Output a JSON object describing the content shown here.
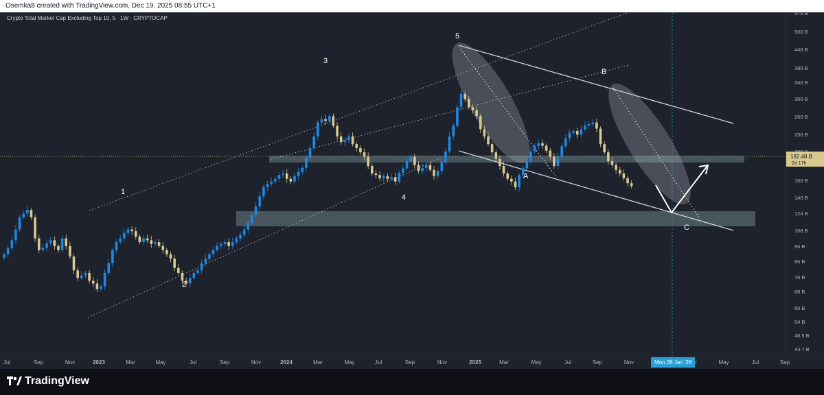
{
  "header": {
    "credit": "Osemka8 created with TradingView.com, Dec 19, 2025 08:55 UTC+1"
  },
  "chart_title": "Crypto Total Market Cap Excluding Top 10, 5 · 1W · CRYPTOCAP",
  "footer": {
    "brand": "TradingView"
  },
  "colors": {
    "up": "#1e88e5",
    "down": "#d8c98f",
    "background": "#1e222d",
    "zone": "#5f7178",
    "crosshair": "#2a9fd6"
  },
  "chart_data": {
    "type": "candlestick",
    "y_scale": "log",
    "y_ticks": [
      "575 B",
      "500 B",
      "440 B",
      "380 B",
      "340 B",
      "300 B",
      "260 B",
      "230 B",
      "200 B",
      "160 B",
      "140 B",
      "124 B",
      "108 B",
      "96 B",
      "86 B",
      "76 B",
      "68 B",
      "60 B",
      "54 B",
      "48.5 B",
      "43.7 B"
    ],
    "x_ticks": [
      "Jul",
      "Sep",
      "Nov",
      "2023",
      "Mar",
      "May",
      "Jul",
      "Sep",
      "Nov",
      "2024",
      "Mar",
      "May",
      "Jul",
      "Sep",
      "Nov",
      "2025",
      "Mar",
      "May",
      "Jul",
      "Sep",
      "Nov",
      "Jan",
      "Mar",
      "May",
      "Jul",
      "Sep"
    ],
    "current_price_label": "192.48 B",
    "countdown_label": "2d 17h",
    "crosshair_date_label": "Mon 26 Jan '26",
    "wave_labels": [
      "1",
      "2",
      "3",
      "4",
      "5",
      "A",
      "B",
      "C"
    ],
    "closes": [
      104,
      110,
      118,
      130,
      145,
      150,
      155,
      145,
      120,
      108,
      110,
      115,
      118,
      112,
      108,
      120,
      112,
      102,
      90,
      84,
      86,
      88,
      82,
      80,
      76,
      78,
      88,
      96,
      108,
      116,
      120,
      126,
      130,
      128,
      122,
      116,
      120,
      118,
      114,
      116,
      112,
      108,
      104,
      100,
      92,
      88,
      82,
      80,
      84,
      88,
      90,
      96,
      100,
      104,
      108,
      112,
      114,
      116,
      112,
      116,
      120,
      124,
      130,
      138,
      148,
      160,
      175,
      190,
      196,
      200,
      205,
      212,
      215,
      205,
      200,
      210,
      218,
      226,
      248,
      270,
      300,
      340,
      350,
      345,
      360,
      330,
      300,
      285,
      290,
      300,
      280,
      270,
      260,
      250,
      230,
      215,
      212,
      206,
      210,
      205,
      208,
      200,
      216,
      225,
      240,
      250,
      232,
      220,
      226,
      232,
      222,
      210,
      220,
      238,
      262,
      300,
      330,
      390,
      440,
      420,
      390,
      380,
      360,
      320,
      300,
      280,
      260,
      245,
      230,
      215,
      205,
      200,
      190,
      212,
      225,
      240,
      262,
      275,
      282,
      276,
      264,
      250,
      230,
      250,
      275,
      295,
      310,
      315,
      305,
      320,
      330,
      335,
      340,
      322,
      280,
      260,
      240,
      232,
      222,
      215,
      206,
      197,
      192
    ],
    "zones": [
      {
        "name": "support-zone-upper",
        "bottom_B": 178,
        "top_B": 184
      },
      {
        "name": "support-zone-lower",
        "bottom_B": 112,
        "top_B": 126
      }
    ]
  }
}
